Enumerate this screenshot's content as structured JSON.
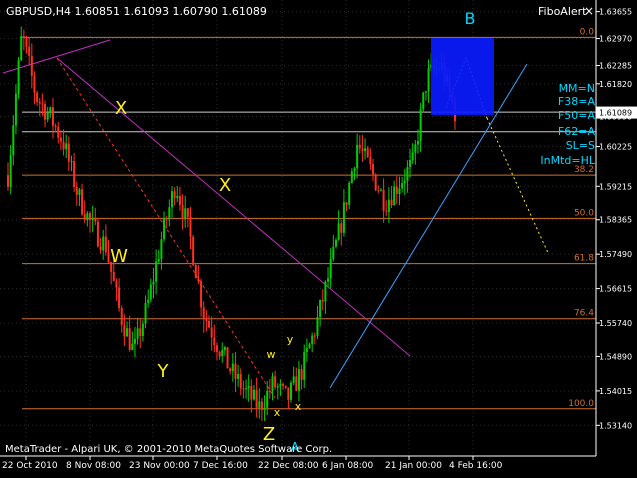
{
  "window": {
    "title": "GBPUSD,H4  1.60851 1.61093 1.60790 1.61089",
    "fibo_tab": "FiboAlert",
    "close_glyph": "×"
  },
  "watermark": "MetaTrader - Alpari UK, © 2001-2010 MetaQuotes Software Corp.",
  "current_price": "1.61089",
  "colors": {
    "background": "#000000",
    "grid": "#2c2c2c",
    "bull": "#00d000",
    "bear": "#ff3020",
    "fibo": "#d2702a",
    "fibo_level_label": "#d2702a",
    "magenta": "#c030c0",
    "cyan_line": "#3aa0ff",
    "box": "#0a1aff",
    "wave_label": "#ffee20",
    "info_text": "#00d8ff",
    "axis_text": "#ffffff"
  },
  "info_panel": [
    "MM=N",
    "F38=A",
    "F50=A",
    "F62=A",
    "SL=S",
    "InMtd=HL"
  ],
  "wave_labels": [
    {
      "text": "X",
      "kind": "major"
    },
    {
      "text": "W",
      "kind": "major"
    },
    {
      "text": "Y",
      "kind": "major"
    },
    {
      "text": "X",
      "kind": "major"
    },
    {
      "text": "Z",
      "kind": "major"
    },
    {
      "text": "w",
      "kind": "minor"
    },
    {
      "text": "y",
      "kind": "minor"
    },
    {
      "text": "x",
      "kind": "minor"
    },
    {
      "text": "x",
      "kind": "minor"
    },
    {
      "text": "A",
      "kind": "cyan"
    },
    {
      "text": "B",
      "kind": "cyan"
    }
  ],
  "chart_data": {
    "type": "candlestick",
    "symbol": "GBPUSD",
    "timeframe": "H4",
    "ylim": [
      1.5236,
      1.6395
    ],
    "y_ticks": [
      "1.63655",
      "1.62970",
      "1.62285",
      "1.61820",
      "1.60990",
      "1.60225",
      "1.59215",
      "1.58365",
      "1.57490",
      "1.56615",
      "1.55740",
      "1.54890",
      "1.54015",
      "1.53140"
    ],
    "x_ticks": [
      "22 Oct 2010",
      "8 Nov 08:00",
      "23 Nov 00:00",
      "7 Dec 16:00",
      "22 Dec 08:00",
      "6 Jan 08:00",
      "21 Jan 00:00",
      "4 Feb 16:00"
    ],
    "fibo_levels": [
      {
        "label": "0.0",
        "price": 1.63
      },
      {
        "label": "38.2",
        "price": 1.595
      },
      {
        "label": "50.0",
        "price": 1.584
      },
      {
        "label": "61.8",
        "price": 1.5725
      },
      {
        "label": "76.4",
        "price": 1.5585
      },
      {
        "label": "100.0",
        "price": 1.5356
      }
    ],
    "extra_levels": [
      1.611,
      1.606
    ],
    "candle_count": 170,
    "wave_path": [
      1.595,
      1.631,
      1.615,
      1.61,
      1.603,
      1.59,
      1.582,
      1.577,
      1.56,
      1.55,
      1.562,
      1.579,
      1.593,
      1.58,
      1.56,
      1.552,
      1.545,
      1.54,
      1.536,
      1.542,
      1.538,
      1.545,
      1.556,
      1.57,
      1.585,
      1.603,
      1.596,
      1.588,
      1.593,
      1.598,
      1.62,
      1.623,
      1.611
    ]
  }
}
